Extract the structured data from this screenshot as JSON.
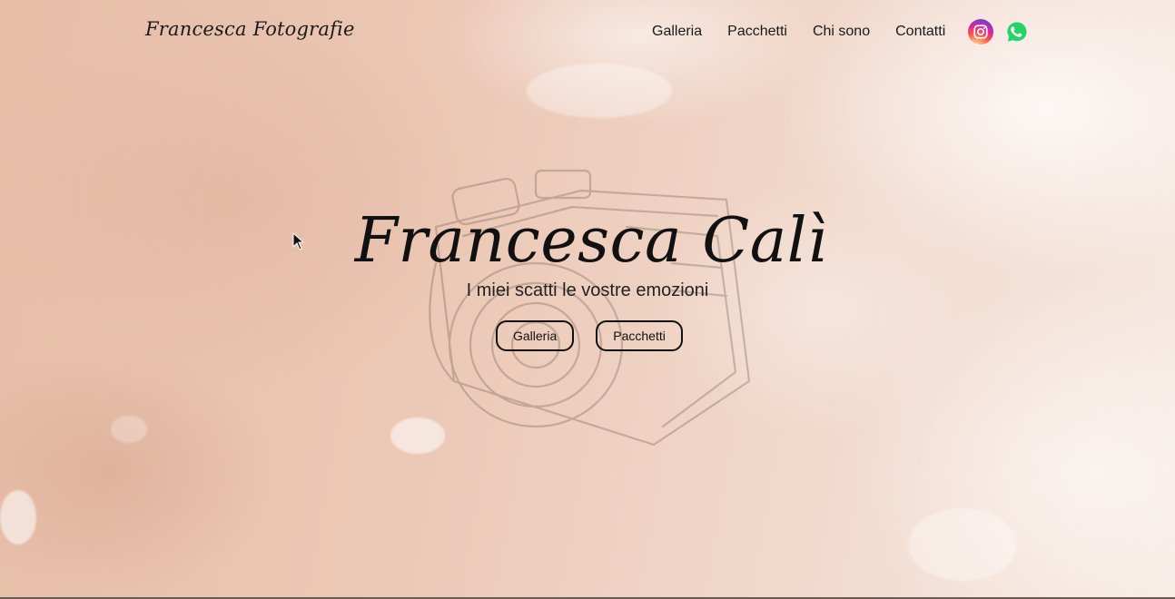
{
  "header": {
    "logo": "Francesca Fotografie",
    "nav": [
      {
        "label": "Galleria"
      },
      {
        "label": "Pacchetti"
      },
      {
        "label": "Chi sono"
      },
      {
        "label": "Contatti"
      }
    ],
    "social": [
      {
        "icon": "instagram-icon"
      },
      {
        "icon": "whatsapp-icon"
      }
    ]
  },
  "hero": {
    "title": "Francesca Calì",
    "subtitle": "I miei scatti le vostre emozioni",
    "buttons": {
      "gallery": "Galleria",
      "packages": "Pacchetti"
    },
    "background_icon": "camera-sketch-icon"
  },
  "colors": {
    "background": "#e9c8b6",
    "text": "#111111",
    "whatsapp": "#25D366"
  }
}
